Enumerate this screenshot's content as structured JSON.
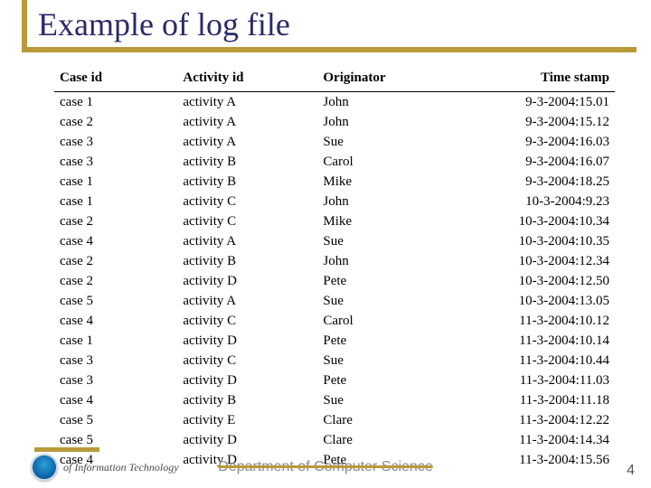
{
  "title": "Example of log file",
  "columns": {
    "case": "Case id",
    "activity": "Activity id",
    "originator": "Originator",
    "timestamp": "Time stamp"
  },
  "rows": [
    {
      "case": "case 1",
      "activity": "activity A",
      "orig": "John",
      "ts": "9-3-2004:15.01"
    },
    {
      "case": "case 2",
      "activity": "activity A",
      "orig": "John",
      "ts": "9-3-2004:15.12"
    },
    {
      "case": "case 3",
      "activity": "activity A",
      "orig": "Sue",
      "ts": "9-3-2004:16.03"
    },
    {
      "case": "case 3",
      "activity": "activity B",
      "orig": "Carol",
      "ts": "9-3-2004:16.07"
    },
    {
      "case": "case 1",
      "activity": "activity B",
      "orig": "Mike",
      "ts": "9-3-2004:18.25"
    },
    {
      "case": "case 1",
      "activity": "activity C",
      "orig": "John",
      "ts": "10-3-2004:9.23"
    },
    {
      "case": "case 2",
      "activity": "activity C",
      "orig": "Mike",
      "ts": "10-3-2004:10.34"
    },
    {
      "case": "case 4",
      "activity": "activity A",
      "orig": "Sue",
      "ts": "10-3-2004:10.35"
    },
    {
      "case": "case 2",
      "activity": "activity B",
      "orig": "John",
      "ts": "10-3-2004:12.34"
    },
    {
      "case": "case 2",
      "activity": "activity D",
      "orig": "Pete",
      "ts": "10-3-2004:12.50"
    },
    {
      "case": "case 5",
      "activity": "activity A",
      "orig": "Sue",
      "ts": "10-3-2004:13.05"
    },
    {
      "case": "case 4",
      "activity": "activity C",
      "orig": "Carol",
      "ts": "11-3-2004:10.12"
    },
    {
      "case": "case 1",
      "activity": "activity D",
      "orig": "Pete",
      "ts": "11-3-2004:10.14"
    },
    {
      "case": "case 3",
      "activity": "activity C",
      "orig": "Sue",
      "ts": "11-3-2004:10.44"
    },
    {
      "case": "case 3",
      "activity": "activity D",
      "orig": "Pete",
      "ts": "11-3-2004:11.03"
    },
    {
      "case": "case 4",
      "activity": "activity B",
      "orig": "Sue",
      "ts": "11-3-2004:11.18"
    },
    {
      "case": "case 5",
      "activity": "activity E",
      "orig": "Clare",
      "ts": "11-3-2004:12.22"
    },
    {
      "case": "case 5",
      "activity": "activity D",
      "orig": "Clare",
      "ts": "11-3-2004:14.34"
    },
    {
      "case": "case 4",
      "activity": "activity D",
      "orig": "Pete",
      "ts": "11-3-2004:15.56"
    }
  ],
  "footer": {
    "badge_text": "of Information Technology",
    "department": "Department of Computer Science",
    "page_number": "4"
  }
}
